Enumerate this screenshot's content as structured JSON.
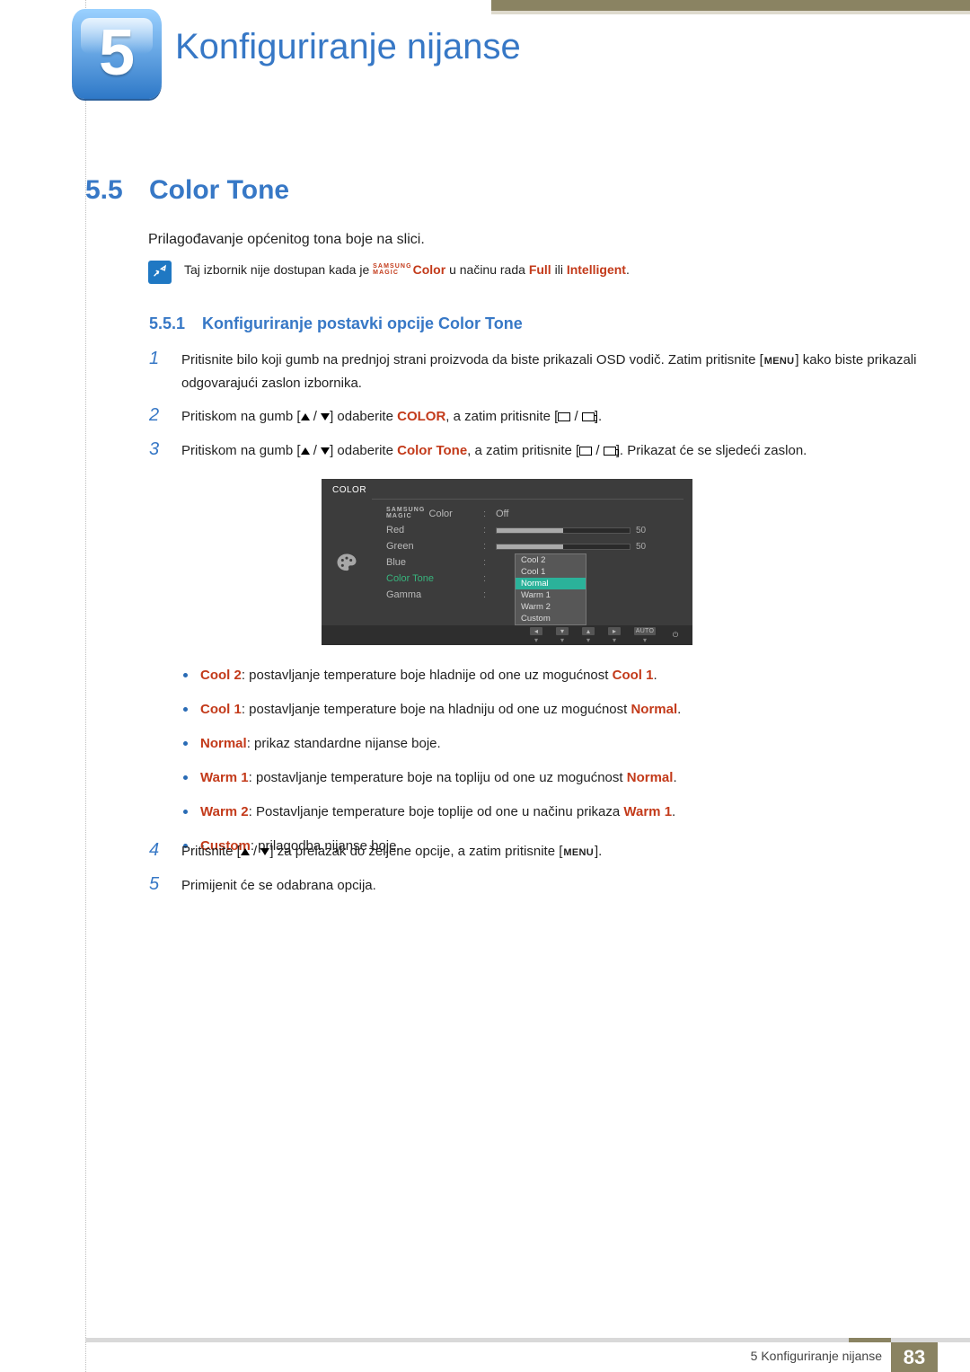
{
  "chapter": {
    "number": "5",
    "title": "Konfiguriranje nijanse"
  },
  "section": {
    "number": "5.5",
    "title": "Color Tone"
  },
  "intro": "Prilagođavanje općenitog tona boje na slici.",
  "note": {
    "pre": "Taj izbornik nije dostupan kada je ",
    "magic1": "SAMSUNG",
    "magic2": "MAGIC",
    "color_word": "Color",
    "mid": " u načinu rada ",
    "full": "Full",
    "or": " ili ",
    "intel": "Intelligent",
    "dot": "."
  },
  "subsection": {
    "number": "5.5.1",
    "title": "Konfiguriranje postavki opcije Color Tone"
  },
  "steps": {
    "s1a": "Pritisnite bilo koji gumb na prednjoj strani proizvoda da biste prikazali OSD vodič. Zatim pritisnite [",
    "menu": "MENU",
    "s1b": "] kako biste prikazali odgovarajući zaslon izbornika.",
    "s2a": "Pritiskom na gumb [",
    "s2b": "] odaberite ",
    "s2_kw": "COLOR",
    "s2c": ", a zatim pritisnite [",
    "s2d": "].",
    "s3a": "Pritiskom na gumb [",
    "s3b": "] odaberite ",
    "s3_kw": "Color Tone",
    "s3c": ", a zatim pritisnite [",
    "s3d": "]. Prikazat će se sljedeći zaslon.",
    "s4a": "Pritisnite [",
    "s4b": "] za prelazak do željene opcije, a zatim pritisnite [",
    "s4c": "].",
    "s5": "Primijenit će se odabrana opcija."
  },
  "osd": {
    "header": "COLOR",
    "rows": {
      "magic": "Color",
      "red": "Red",
      "green": "Green",
      "blue": "Blue",
      "colortone": "Color Tone",
      "gamma": "Gamma"
    },
    "off": "Off",
    "val50a": "50",
    "val50b": "50",
    "dropdown": [
      "Cool 2",
      "Cool 1",
      "Normal",
      "Warm 1",
      "Warm 2",
      "Custom"
    ],
    "auto": "AUTO"
  },
  "bullets": [
    {
      "kw": "Cool 2",
      "t": ": postavljanje temperature boje hladnije od one uz mogućnost ",
      "kw2": "Cool 1",
      "t2": "."
    },
    {
      "kw": "Cool 1",
      "t": ": postavljanje temperature boje na hladniju od one uz mogućnost ",
      "kw2": "Normal",
      "t2": "."
    },
    {
      "kw": "Normal",
      "t": ": prikaz standardne nijanse boje.",
      "kw2": "",
      "t2": ""
    },
    {
      "kw": "Warm 1",
      "t": ": postavljanje temperature boje na topliju od one uz mogućnost ",
      "kw2": "Normal",
      "t2": "."
    },
    {
      "kw": "Warm 2",
      "t": ": Postavljanje temperature boje toplije od one u načinu prikaza ",
      "kw2": "Warm 1",
      "t2": "."
    },
    {
      "kw": "Custom",
      "t": ": prilagodba nijanse boje.",
      "kw2": "",
      "t2": ""
    }
  ],
  "footer": {
    "text": "5 Konfiguriranje nijanse",
    "page": "83"
  }
}
